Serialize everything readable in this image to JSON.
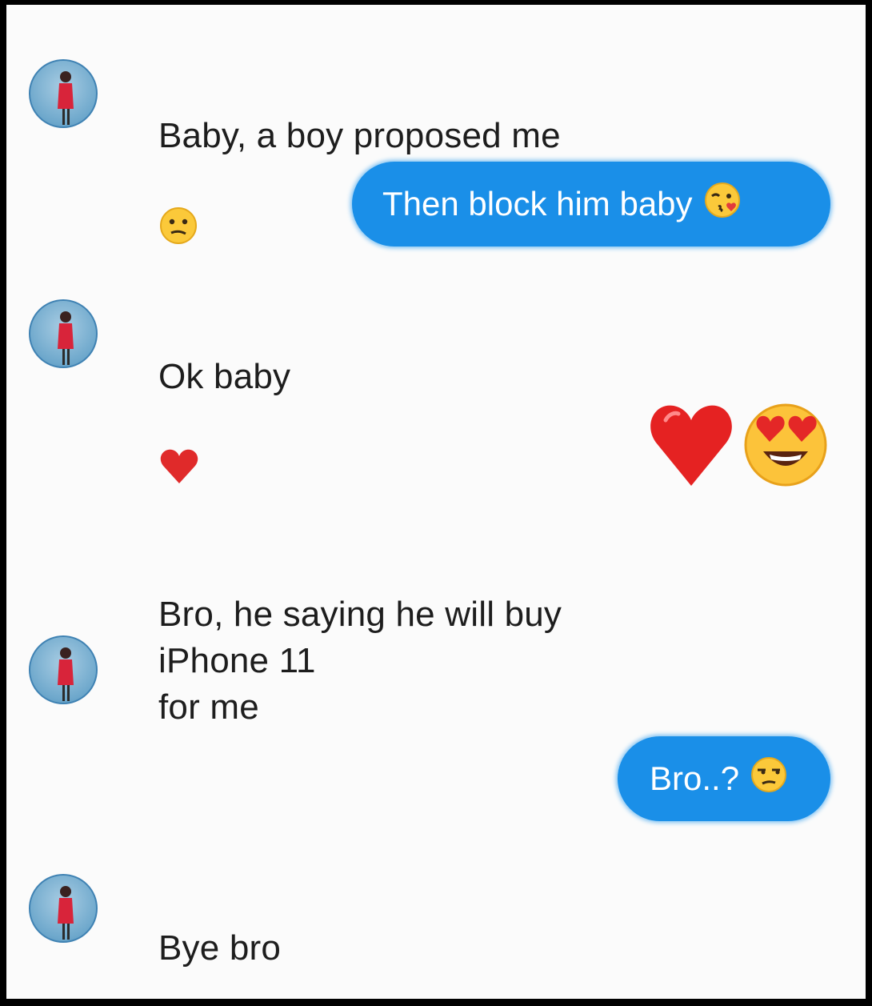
{
  "conversation": {
    "messages": [
      {
        "side": "incoming",
        "text": "Baby, a boy proposed me",
        "emoji": "confused-face-emoji"
      },
      {
        "side": "outgoing",
        "text": "Then block him baby",
        "emoji": "face-blowing-kiss-emoji"
      },
      {
        "side": "incoming",
        "text": "Ok baby",
        "emoji": "red-heart-emoji"
      },
      {
        "side": "outgoing",
        "text": "",
        "emoji": [
          "red-heart-emoji",
          "heart-eyes-face-emoji"
        ]
      },
      {
        "side": "incoming",
        "text": "Bro, he saying he will buy\niPhone 11\nfor me",
        "emoji": ""
      },
      {
        "side": "outgoing",
        "text": "Bro..?",
        "emoji": "unamused-face-emoji"
      },
      {
        "side": "incoming",
        "text": "Bye bro",
        "emoji": ""
      }
    ]
  },
  "colors": {
    "outgoing_bubble": "#1a8fe8",
    "background": "#fbfbfb",
    "incoming_text": "#1d1d1d"
  }
}
